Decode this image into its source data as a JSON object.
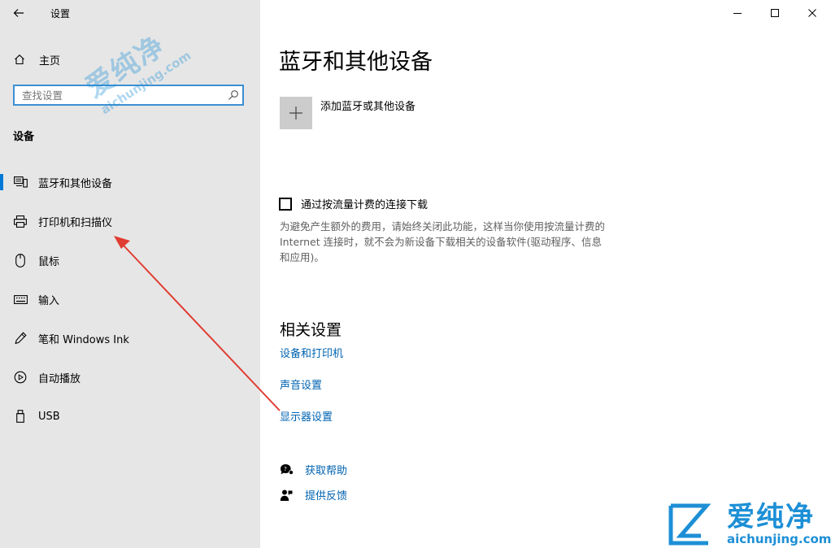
{
  "window": {
    "app_title": "设置",
    "controls": {
      "minimize": "minimize-icon",
      "maximize": "maximize-icon",
      "close": "close-icon"
    }
  },
  "sidebar": {
    "home_label": "主页",
    "search": {
      "placeholder": "查找设置",
      "value": ""
    },
    "section_title": "设备",
    "items": [
      {
        "label": "蓝牙和其他设备",
        "icon": "bluetooth-devices-icon",
        "selected": true
      },
      {
        "label": "打印机和扫描仪",
        "icon": "printer-icon",
        "selected": false
      },
      {
        "label": "鼠标",
        "icon": "mouse-icon",
        "selected": false
      },
      {
        "label": "输入",
        "icon": "keyboard-icon",
        "selected": false
      },
      {
        "label": "笔和 Windows Ink",
        "icon": "pen-icon",
        "selected": false
      },
      {
        "label": "自动播放",
        "icon": "autoplay-icon",
        "selected": false
      },
      {
        "label": "USB",
        "icon": "usb-icon",
        "selected": false
      }
    ]
  },
  "main": {
    "title": "蓝牙和其他设备",
    "add_device_label": "添加蓝牙或其他设备",
    "metered": {
      "label": "通过按流量计费的连接下载",
      "checked": false,
      "description": [
        "为避免产生额外的费用，请始终关闭此功能，这样当你使用按流量计费的",
        "Internet 连接时，就不会为新设备下载相关的设备软件(驱动程序、信息",
        "和应用)。"
      ]
    },
    "related_title": "相关设置",
    "related_links": [
      "设备和打印机",
      "声音设置",
      "显示器设置"
    ],
    "help": [
      {
        "label": "获取帮助",
        "icon": "help-chat-icon"
      },
      {
        "label": "提供反馈",
        "icon": "feedback-icon"
      }
    ]
  },
  "watermark": {
    "text": "爱纯净",
    "url": "aichunjing.com"
  },
  "colors": {
    "accent": "#0078d7",
    "link": "#0063b1",
    "annotation_arrow": "#e03c31",
    "sidebar_bg": "#e6e6e6"
  }
}
